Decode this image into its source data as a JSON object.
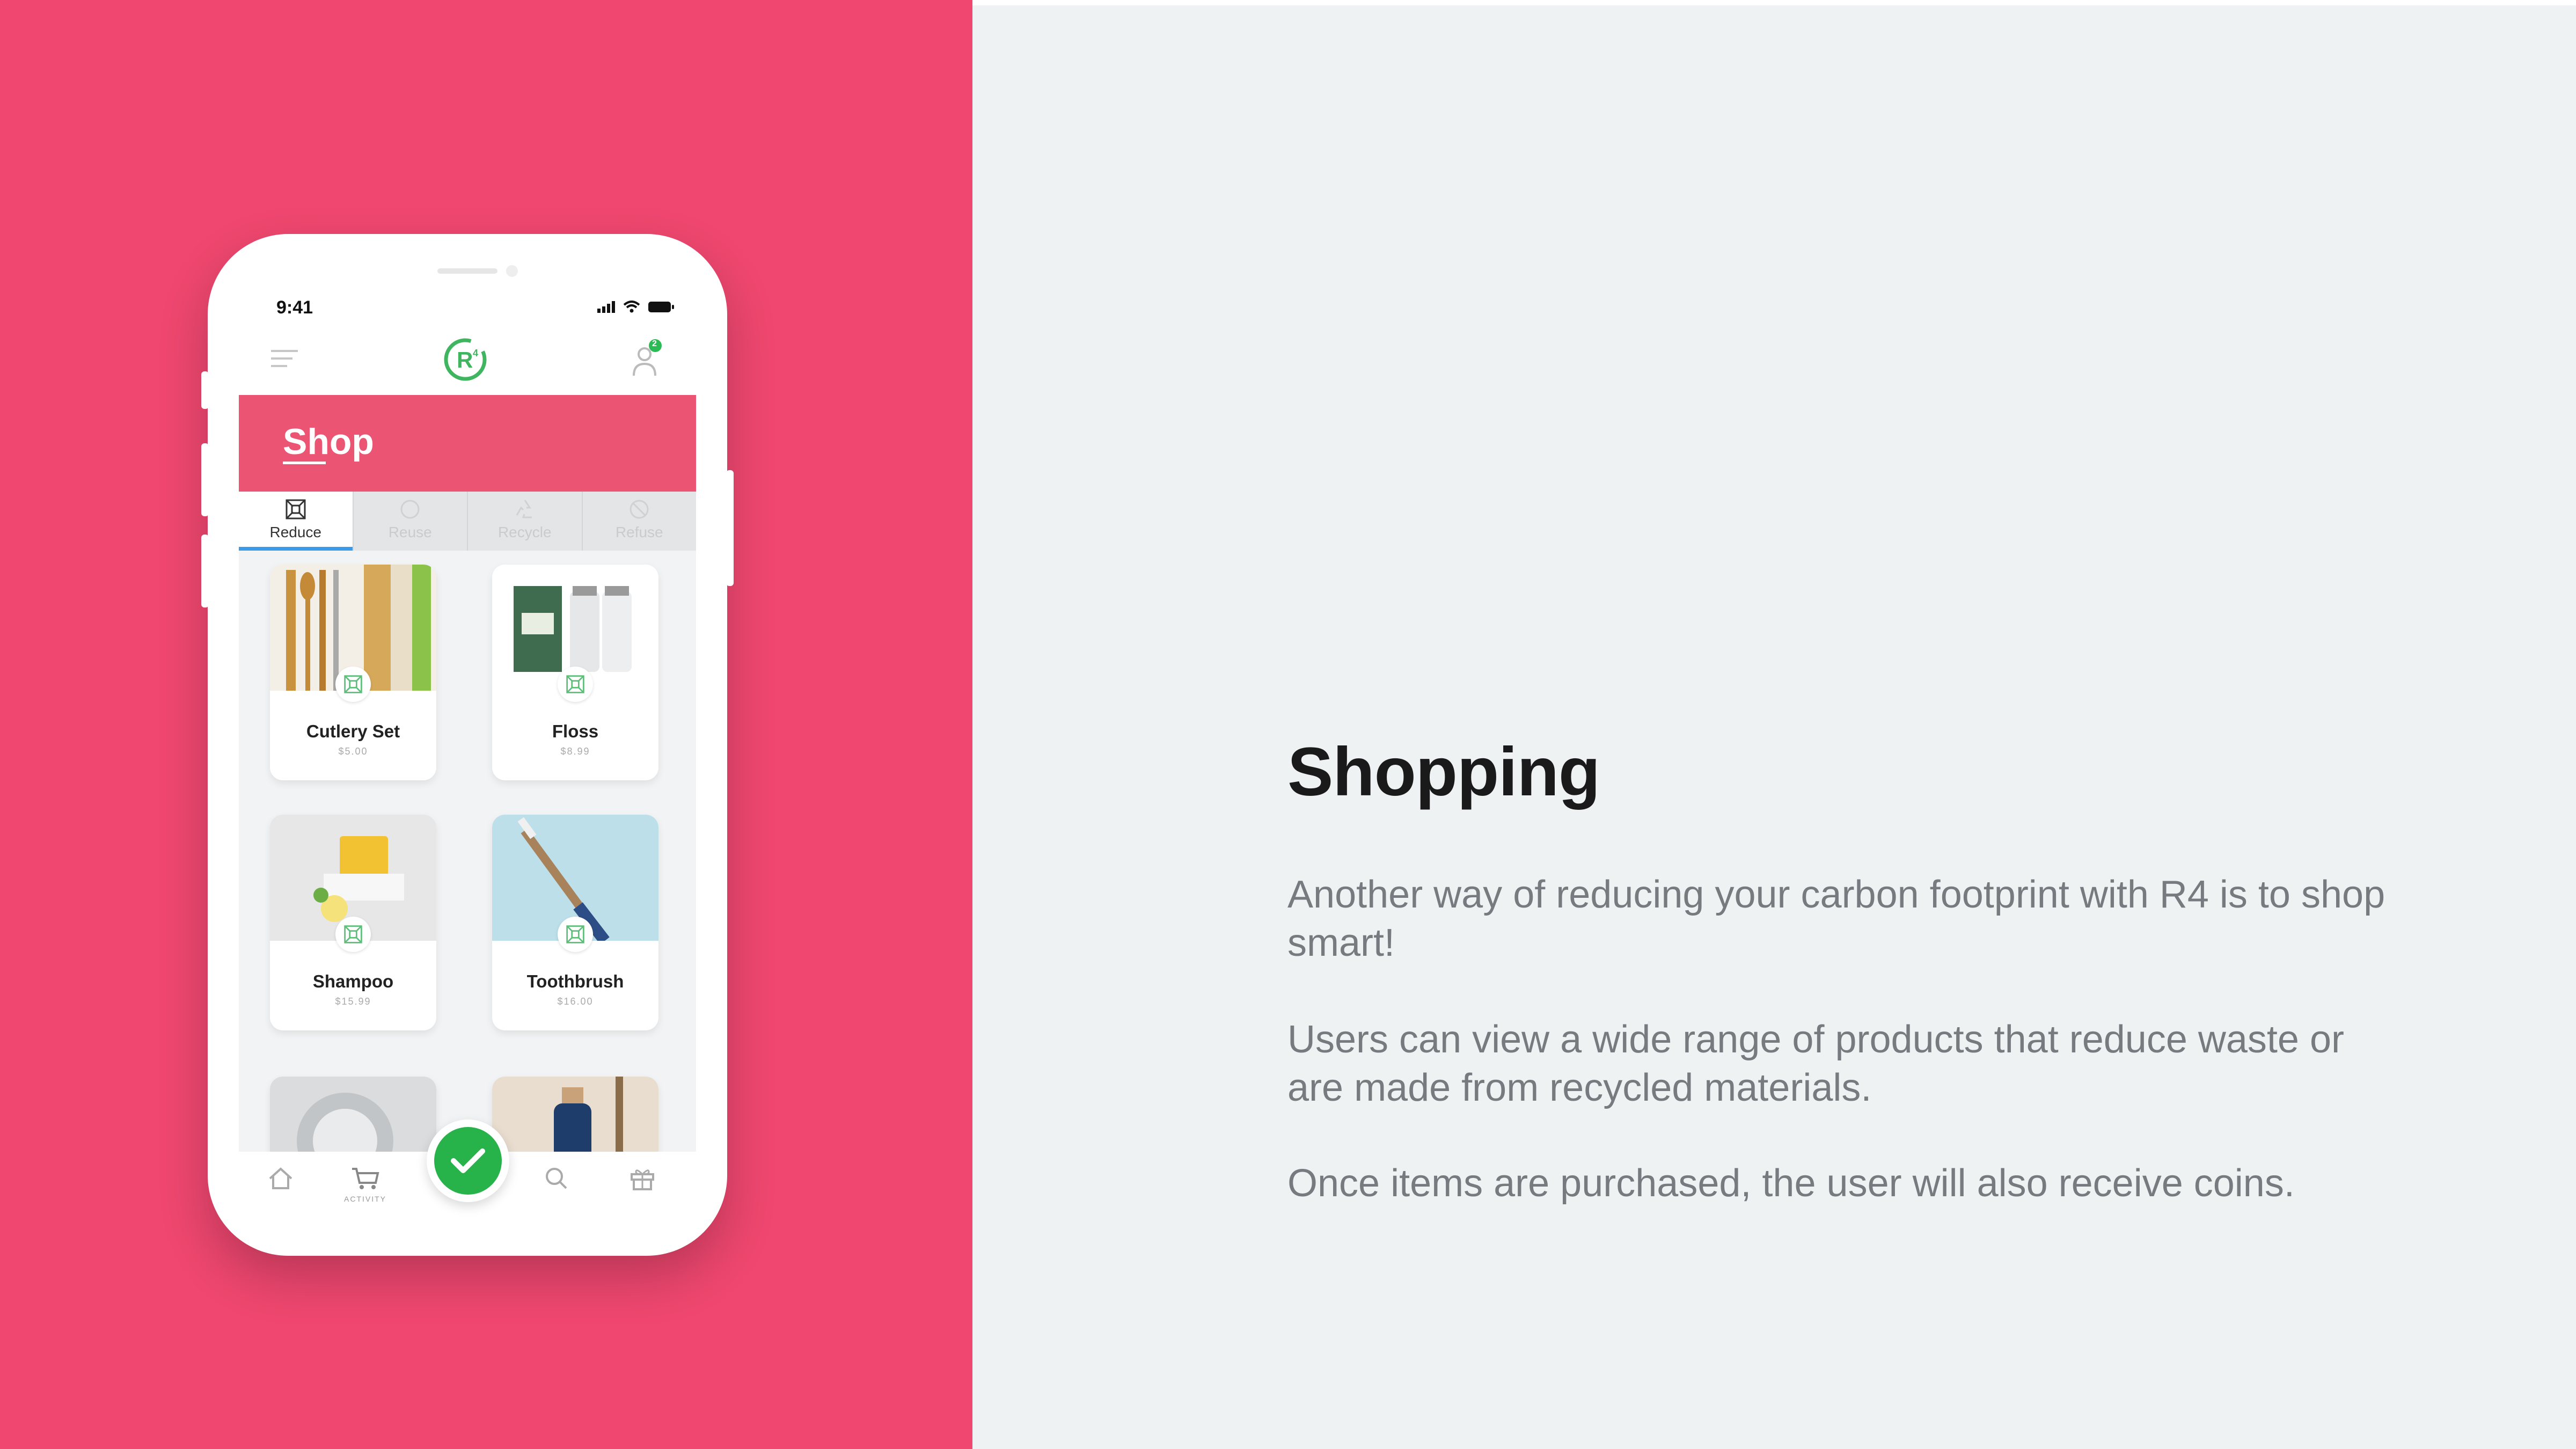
{
  "colors": {
    "left_background": "#ef476f",
    "right_background": "#eff2f3",
    "shop_banner": "#ec5474",
    "active_tab_indicator": "#3b9be8",
    "fab": "#27b24a",
    "logo_green": "#3fb560"
  },
  "phone": {
    "status_time": "9:41",
    "header": {
      "menu_icon": "menu-icon",
      "logo_icon": "r4-logo",
      "profile_icon": "user-icon",
      "notification_count": "2"
    },
    "page_title": "Shop",
    "tabs": [
      {
        "label": "Reduce",
        "icon": "reduce-icon",
        "active": true
      },
      {
        "label": "Reuse",
        "icon": "reuse-icon",
        "active": false
      },
      {
        "label": "Recycle",
        "icon": "recycle-icon",
        "active": false
      },
      {
        "label": "Refuse",
        "icon": "refuse-icon",
        "active": false
      }
    ],
    "products": [
      {
        "name": "Cutlery Set",
        "price": "$5.00"
      },
      {
        "name": "Floss",
        "price": "$8.99"
      },
      {
        "name": "Shampoo",
        "price": "$15.99"
      },
      {
        "name": "Toothbrush",
        "price": "$16.00"
      }
    ],
    "bottom_nav": [
      {
        "icon": "home-icon",
        "label": ""
      },
      {
        "icon": "cart-icon",
        "label": "ACTIVITY"
      },
      {
        "icon": "check-icon",
        "label": ""
      },
      {
        "icon": "search-icon",
        "label": ""
      },
      {
        "icon": "gift-icon",
        "label": ""
      }
    ]
  },
  "description": {
    "heading": "Shopping",
    "paragraphs": [
      "Another way of reducing your carbon footprint with R4 is to shop smart!",
      "Users can view a wide range of products that reduce waste or are made from recycled materials.",
      "Once items are purchased, the user will also receive coins."
    ]
  }
}
